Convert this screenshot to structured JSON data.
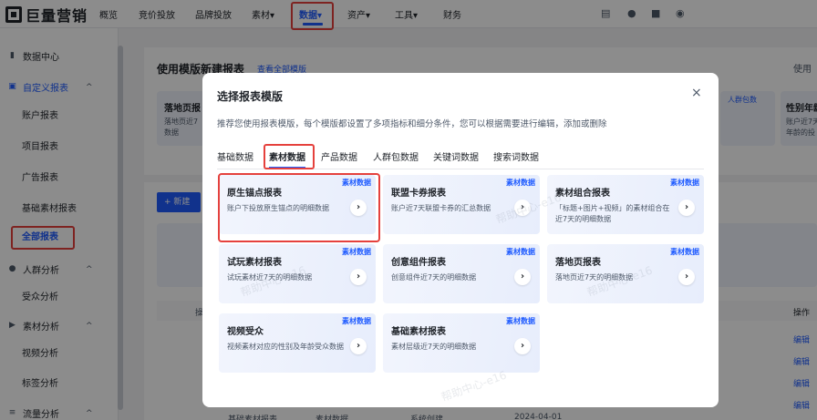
{
  "topnav": {
    "logo_text": "巨量营销",
    "items": [
      "概览",
      "竞价投放",
      "品牌投放",
      "素材",
      "数据",
      "资产",
      "工具",
      "财务"
    ],
    "dropdown_caret": "▾"
  },
  "sidebar": {
    "groups": [
      {
        "label": "数据中心",
        "icon": "bar-chart-icon"
      },
      {
        "label": "自定义报表",
        "icon": "report-icon",
        "chevron": "^"
      },
      {
        "label": "人群分析",
        "icon": "user-icon",
        "chevron": "^"
      },
      {
        "label": "素材分析",
        "icon": "video-icon",
        "chevron": "^"
      },
      {
        "label": "流量分析",
        "icon": "flow-icon",
        "chevron": "^"
      }
    ],
    "items": [
      "账户报表",
      "项目报表",
      "广告报表",
      "基础素材报表",
      "全部报表",
      "受众分析",
      "视频分析",
      "标签分析"
    ]
  },
  "background": {
    "page_title": "使用模版新建报表",
    "page_link": "查看全部模版",
    "right_text": "使用",
    "card_left_title": "落地页报",
    "card_left_desc1": "落地页近7",
    "card_left_desc2": "数据",
    "card_right_title": "性别年龄",
    "card_right_desc1": "账户近7天",
    "card_right_desc2": "年龄的投",
    "card_right_badge": "人群包数",
    "new_button": "+ 新建",
    "ops_header": "操作",
    "edit_label": "编辑",
    "table_col": "操",
    "bottom_row": [
      "基础素材报表",
      "素材数据",
      "系统创建",
      "2024-04-01"
    ]
  },
  "modal": {
    "title": "选择报表模版",
    "close": "×",
    "description": "推荐您使用报表模版，每个模版都设置了多项指标和细分条件，您可以根据需要进行编辑，添加或删除",
    "tabs": [
      "基础数据",
      "素材数据",
      "产品数据",
      "人群包数据",
      "关键词数据",
      "搜索词数据"
    ],
    "active_tab": "素材数据",
    "cards": [
      {
        "title": "原生锚点报表",
        "desc": "账户下投放原生锚点的明细数据",
        "badge": "素材数据"
      },
      {
        "title": "联盟卡券报表",
        "desc": "账户近7天联盟卡券的汇总数据",
        "badge": "素材数据"
      },
      {
        "title": "素材组合报表",
        "desc": "「标题+图片+视频」的素材组合在近7天的明细数据",
        "badge": "素材数据"
      },
      {
        "title": "试玩素材报表",
        "desc": "试玩素材近7天的明细数据",
        "badge": "素材数据"
      },
      {
        "title": "创意组件报表",
        "desc": "创意组件近7天的明细数据",
        "badge": "素材数据"
      },
      {
        "title": "落地页报表",
        "desc": "落地页近7天的明细数据",
        "badge": "素材数据"
      },
      {
        "title": "视频受众",
        "desc": "视频素材对应的性别及年龄受众数据",
        "badge": "素材数据"
      },
      {
        "title": "基础素材报表",
        "desc": "素材层级近7天的明细数据",
        "badge": "素材数据"
      }
    ],
    "arrow": "›"
  },
  "watermark_text": "帮助中心-e16"
}
